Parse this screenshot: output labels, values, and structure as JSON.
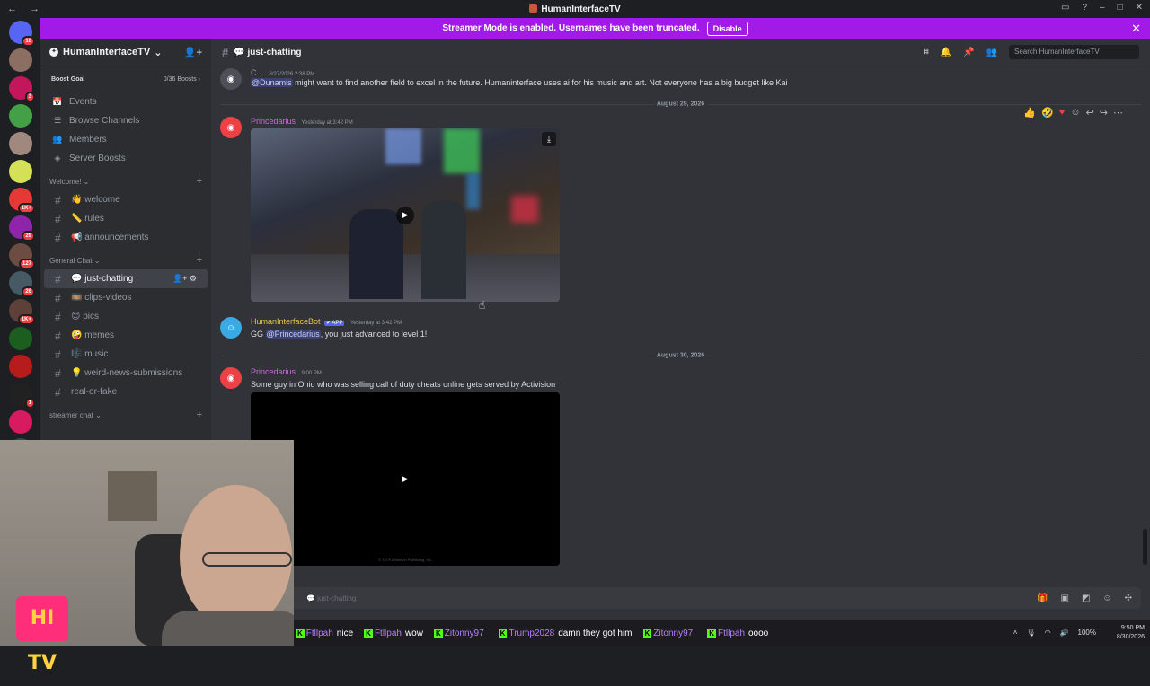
{
  "titlebar": {
    "title": "HumanInterfaceTV"
  },
  "banner": {
    "text": "Streamer Mode is enabled. Usernames have been truncated.",
    "button": "Disable"
  },
  "servers": {
    "items": [
      {
        "color": "#5865f2",
        "badge": "10"
      },
      {
        "color": "#8d6e63",
        "badge": ""
      },
      {
        "color": "#c2185b",
        "badge": "3"
      },
      {
        "color": "#43a047",
        "badge": ""
      },
      {
        "color": "#a1887f",
        "badge": ""
      },
      {
        "color": "#d4e157",
        "badge": ""
      },
      {
        "color": "#e53935",
        "badge": "1K+"
      },
      {
        "color": "#8e24aa",
        "badge": "29"
      },
      {
        "color": "#6d4c41",
        "badge": "127"
      },
      {
        "color": "#455a64",
        "badge": "26"
      },
      {
        "color": "#5d4037",
        "badge": "1K+"
      },
      {
        "color": "#1b5e20",
        "badge": ""
      },
      {
        "color": "#b71c1c",
        "badge": ""
      },
      {
        "color": "#212121",
        "badge": "1"
      },
      {
        "color": "#d81b60",
        "badge": ""
      },
      {
        "color": "#37474f",
        "badge": ""
      }
    ]
  },
  "guild": {
    "name": "HumanInterfaceTV",
    "boost_label": "Boost Goal",
    "boost_count": "0/36 Boosts"
  },
  "sidebar": {
    "top_items": [
      {
        "icon": "📅",
        "label": "Events"
      },
      {
        "icon": "☰",
        "label": "Browse Channels"
      },
      {
        "icon": "👥",
        "label": "Members"
      },
      {
        "icon": "◈",
        "label": "Server Boosts"
      }
    ],
    "categories": [
      {
        "label": "Welcome! ⌄",
        "channels": [
          {
            "label": "👋 welcome",
            "active": false
          },
          {
            "label": "📏 rules",
            "active": false
          },
          {
            "label": "📢 announcements",
            "active": false
          }
        ]
      },
      {
        "label": "General Chat ⌄",
        "channels": [
          {
            "label": "💬 just-chatting",
            "active": true
          },
          {
            "label": "🎞️ clips-videos",
            "active": false
          },
          {
            "label": "😊 pics",
            "active": false
          },
          {
            "label": "🤪 memes",
            "active": false
          },
          {
            "label": "🎼 music",
            "active": false
          },
          {
            "label": "💡 weird-news-submissions",
            "active": false
          },
          {
            "label": "real-or-fake",
            "active": false
          }
        ]
      },
      {
        "label": "streamer chat ⌄",
        "channels": []
      }
    ]
  },
  "channel": {
    "name": "💬 just-chatting",
    "search_placeholder": "Search HumanInterfaceTV"
  },
  "messages": {
    "m1": {
      "author": "C...",
      "time": "8/27/2026 2:38 PM",
      "mention": "@Dunamis",
      "text": " might want to find another field to excel in the future.  Humaninterface uses ai for his music and art. Not everyone has a big budget like Kai"
    },
    "divider1": "August 29, 2026",
    "m2": {
      "author": "Princedarius",
      "time": "Yesterday at 3:42 PM"
    },
    "m3": {
      "author": "HumanInterfaceBot",
      "badge": "✔ APP",
      "time": "Yesterday at 3:42 PM",
      "prefix": "GG ",
      "mention": "@Princedarius",
      "text": ", you just advanced to level 1!"
    },
    "divider2": "August 30, 2026",
    "m4": {
      "author": "Princedarius",
      "time": "9:00 PM",
      "text": "Some guy in Ohio who was selling call of duty cheats online gets served by Activision",
      "video_footer": "© TM ® Activision Publishing, Inc."
    }
  },
  "composer": {
    "placeholder": "💬 just-chatting"
  },
  "taskbar": {
    "ticker": [
      {
        "name": "Ftllpah",
        "text": "nice"
      },
      {
        "name": "Ftllpah",
        "text": "wow"
      },
      {
        "name": "Zitonny97",
        "text": ""
      },
      {
        "name": "Trump2028",
        "text": "damn they got him"
      },
      {
        "name": "Zitonny97",
        "text": ""
      },
      {
        "name": "Ftllpah",
        "text": "oooo"
      }
    ],
    "search": "Search",
    "battery": "100%",
    "time": "9:50 PM",
    "date": "8/30/2026"
  },
  "webcam_logo": "HI TV"
}
